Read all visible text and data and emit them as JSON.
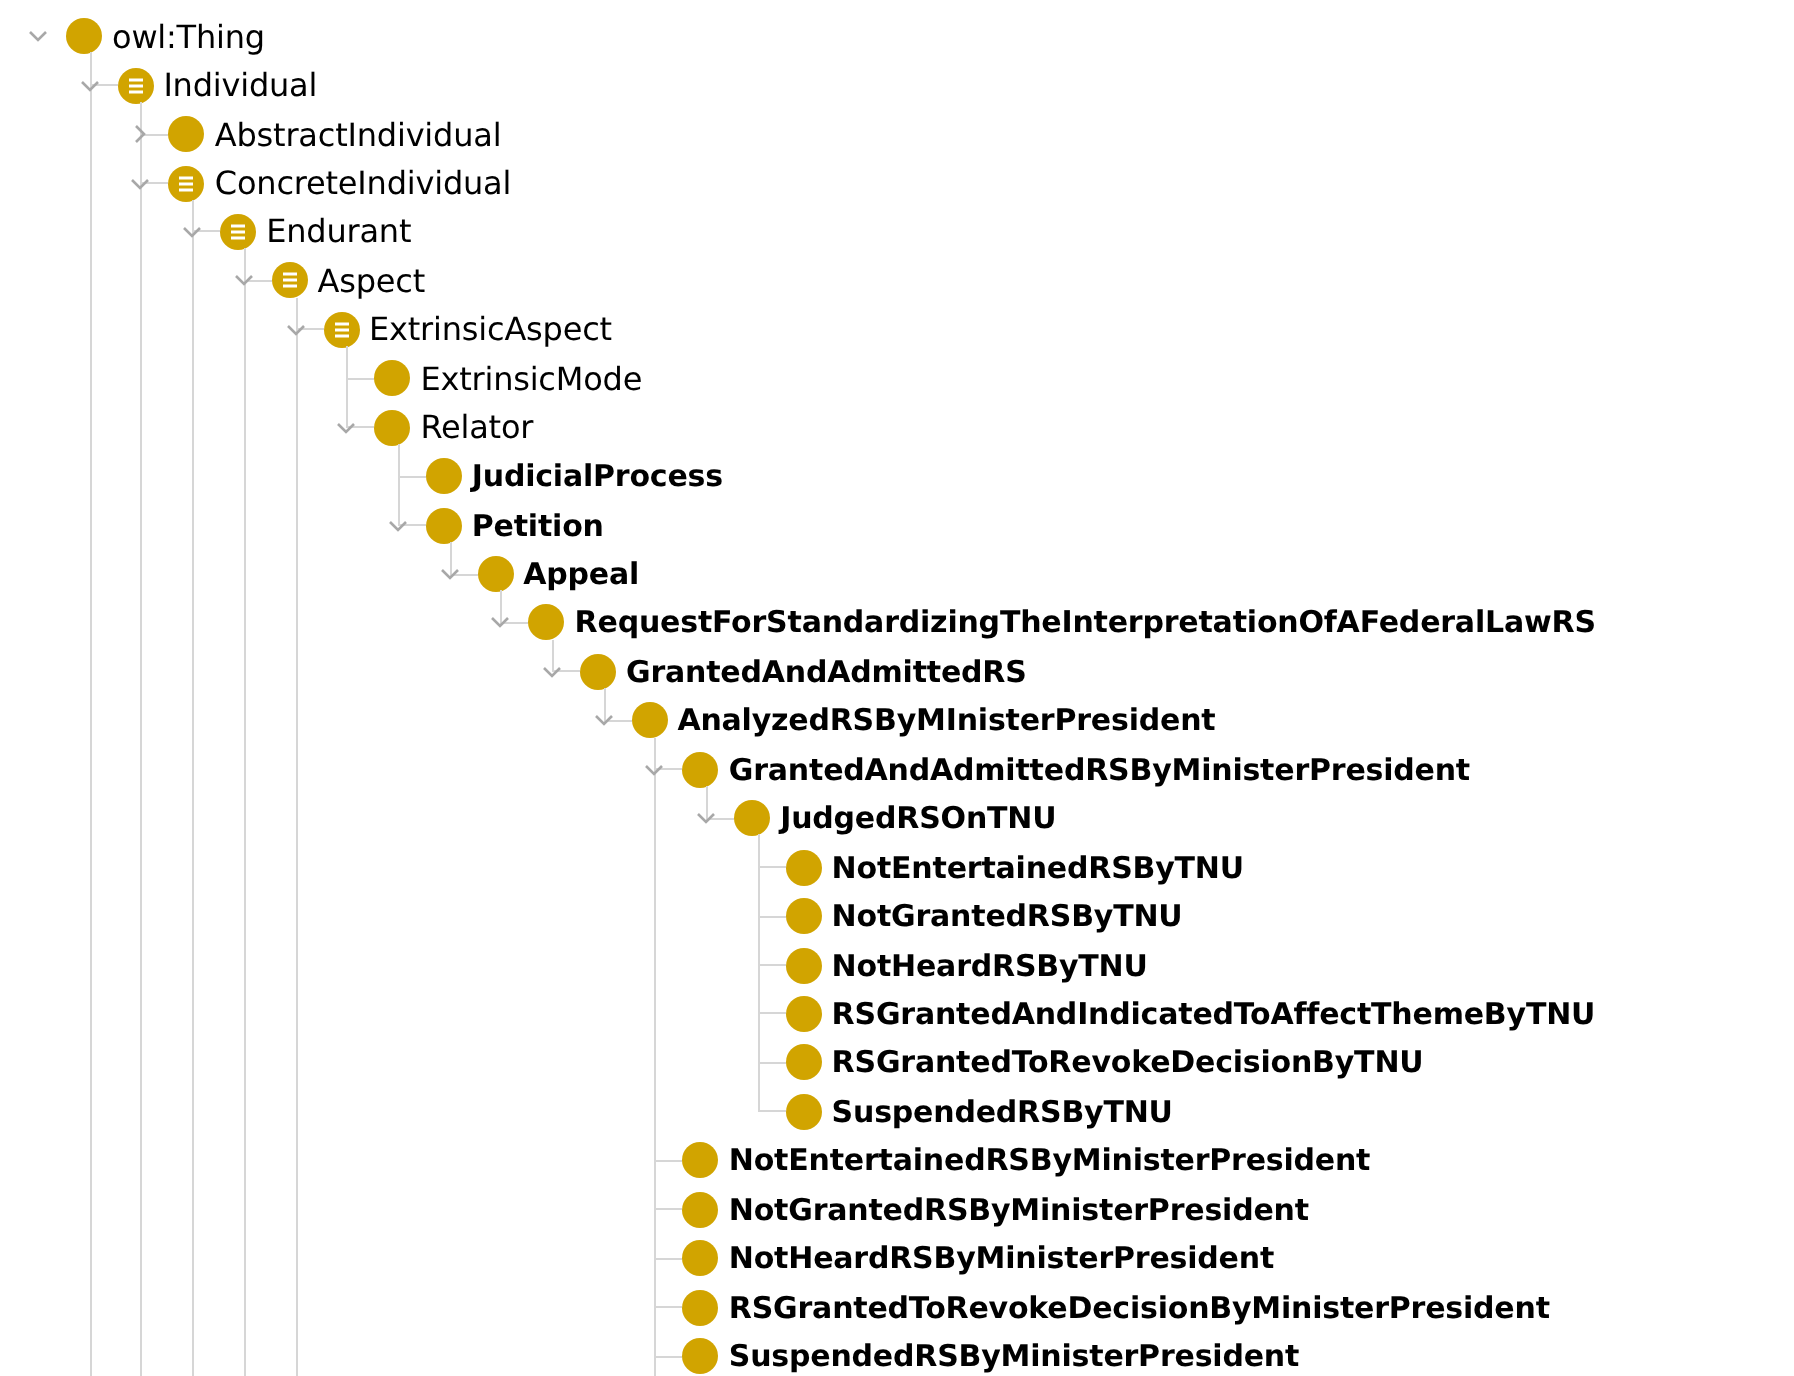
{
  "tree": [
    {
      "label": "owl:Thing",
      "kind": "class",
      "bold": false,
      "expanded": true,
      "continued": true,
      "children": [
        {
          "label": "Individual",
          "kind": "defined",
          "bold": false,
          "expanded": true,
          "continued": true,
          "children": [
            {
              "label": "AbstractIndividual",
              "kind": "class",
              "bold": false,
              "expanded": false
            },
            {
              "label": "ConcreteIndividual",
              "kind": "defined",
              "bold": false,
              "expanded": true,
              "continued": true,
              "children": [
                {
                  "label": "Endurant",
                  "kind": "defined",
                  "bold": false,
                  "expanded": true,
                  "continued": true,
                  "children": [
                    {
                      "label": "Aspect",
                      "kind": "defined",
                      "bold": false,
                      "expanded": true,
                      "continued": true,
                      "children": [
                        {
                          "label": "ExtrinsicAspect",
                          "kind": "defined",
                          "bold": false,
                          "expanded": true,
                          "continued": false,
                          "children": [
                            {
                              "label": "ExtrinsicMode",
                              "kind": "class",
                              "bold": false
                            },
                            {
                              "label": "Relator",
                              "kind": "class",
                              "bold": false,
                              "expanded": true,
                              "continued": false,
                              "children": [
                                {
                                  "label": "JudicialProcess",
                                  "kind": "class",
                                  "bold": true
                                },
                                {
                                  "label": "Petition",
                                  "kind": "class",
                                  "bold": true,
                                  "expanded": true,
                                  "continued": false,
                                  "children": [
                                    {
                                      "label": "Appeal",
                                      "kind": "class",
                                      "bold": true,
                                      "expanded": true,
                                      "continued": false,
                                      "children": [
                                        {
                                          "label": "RequestForStandardizingTheInterpretationOfAFederalLawRS",
                                          "kind": "class",
                                          "bold": true,
                                          "expanded": true,
                                          "continued": false,
                                          "children": [
                                            {
                                              "label": "GrantedAndAdmittedRS",
                                              "kind": "class",
                                              "bold": true,
                                              "expanded": true,
                                              "continued": false,
                                              "children": [
                                                {
                                                  "label": "AnalyzedRSByMInisterPresident",
                                                  "kind": "class",
                                                  "bold": true,
                                                  "expanded": true,
                                                  "continued": true,
                                                  "children": [
                                                    {
                                                      "label": "GrantedAndAdmittedRSByMinisterPresident",
                                                      "kind": "class",
                                                      "bold": true,
                                                      "expanded": true,
                                                      "continued": false,
                                                      "children": [
                                                        {
                                                          "label": "JudgedRSOnTNU",
                                                          "kind": "class",
                                                          "bold": true,
                                                          "expanded": true,
                                                          "continued": false,
                                                          "children": [
                                                            {
                                                              "label": "NotEntertainedRSByTNU",
                                                              "kind": "class",
                                                              "bold": true
                                                            },
                                                            {
                                                              "label": "NotGrantedRSByTNU",
                                                              "kind": "class",
                                                              "bold": true
                                                            },
                                                            {
                                                              "label": "NotHeardRSByTNU",
                                                              "kind": "class",
                                                              "bold": true
                                                            },
                                                            {
                                                              "label": "RSGrantedAndIndicatedToAffectThemeByTNU",
                                                              "kind": "class",
                                                              "bold": true
                                                            },
                                                            {
                                                              "label": "RSGrantedToRevokeDecisionByTNU",
                                                              "kind": "class",
                                                              "bold": true
                                                            },
                                                            {
                                                              "label": "SuspendedRSByTNU",
                                                              "kind": "class",
                                                              "bold": true
                                                            }
                                                          ]
                                                        }
                                                      ]
                                                    },
                                                    {
                                                      "label": "NotEntertainedRSByMinisterPresident",
                                                      "kind": "class",
                                                      "bold": true
                                                    },
                                                    {
                                                      "label": "NotGrantedRSByMinisterPresident",
                                                      "kind": "class",
                                                      "bold": true
                                                    },
                                                    {
                                                      "label": "NotHeardRSByMinisterPresident",
                                                      "kind": "class",
                                                      "bold": true
                                                    },
                                                    {
                                                      "label": "RSGrantedToRevokeDecisionByMinisterPresident",
                                                      "kind": "class",
                                                      "bold": true
                                                    },
                                                    {
                                                      "label": "SuspendedRSByMinisterPresident",
                                                      "kind": "class",
                                                      "bold": true
                                                    }
                                                  ]
                                                }
                                              ]
                                            }
                                          ]
                                        }
                                      ]
                                    }
                                  ]
                                }
                              ]
                            }
                          ]
                        }
                      ]
                    }
                  ]
                }
              ]
            }
          ]
        }
      ]
    }
  ]
}
